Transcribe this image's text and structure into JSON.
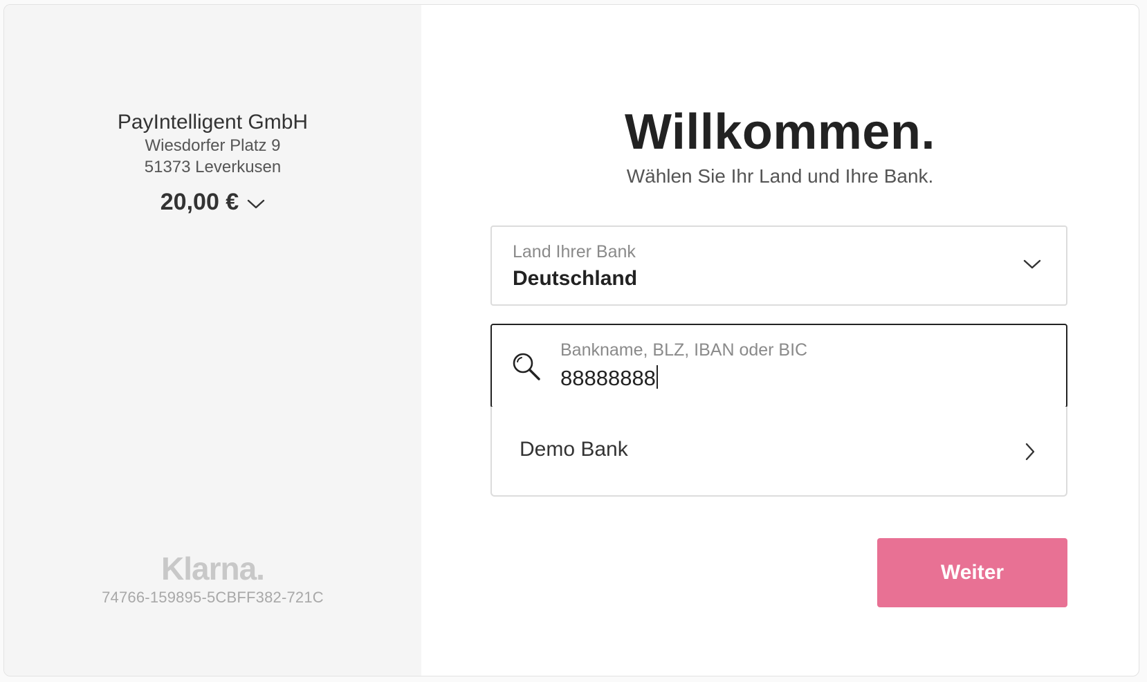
{
  "merchant": {
    "name": "PayIntelligent GmbH",
    "street": "Wiesdorfer Platz 9",
    "city": "51373 Leverkusen",
    "amount": "20,00 €"
  },
  "klarna": {
    "logo_text": "Klarna.",
    "transaction_id": "74766-159895-5CBFF382-721C"
  },
  "main": {
    "title": "Willkommen.",
    "subtitle": "Wählen Sie Ihr Land und Ihre Bank."
  },
  "country_select": {
    "label": "Land Ihrer Bank",
    "value": "Deutschland"
  },
  "bank_search": {
    "placeholder": "Bankname, BLZ, IBAN oder BIC",
    "value": "88888888"
  },
  "bank_results": [
    {
      "name": "Demo Bank"
    }
  ],
  "actions": {
    "continue_label": "Weiter"
  },
  "colors": {
    "accent": "#e87194",
    "left_panel": "#f5f5f5",
    "text_dark": "#222222"
  },
  "icons": {
    "amount_toggle": "chevron-down-icon",
    "country_toggle": "chevron-down-icon",
    "search": "search-icon",
    "bank_result": "chevron-right-icon"
  }
}
